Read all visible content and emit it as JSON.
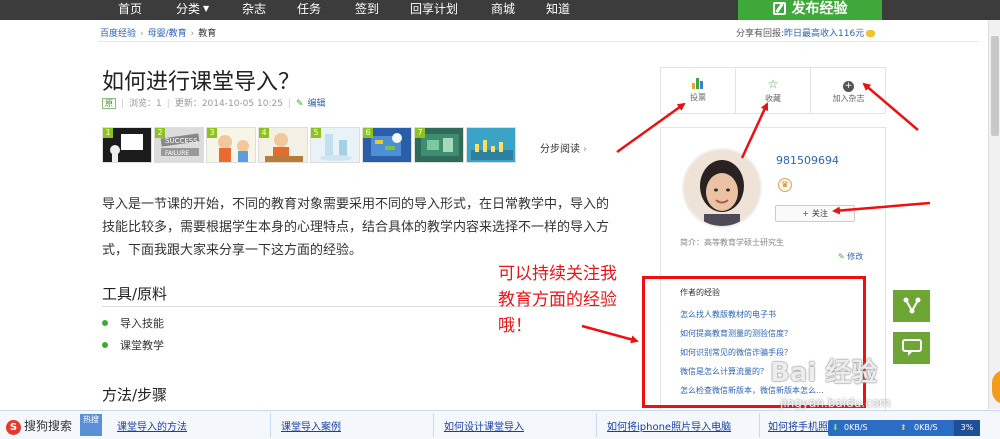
{
  "topnav": {
    "items": [
      "首页",
      "分类",
      "杂志",
      "任务",
      "签到",
      "回享计划",
      "商城",
      "知道"
    ],
    "publish_label": "发布经验"
  },
  "breadcrumb": {
    "items": [
      "百度经验",
      "母婴/教育",
      "教育"
    ],
    "share_tip_prefix": "分享有回报:",
    "share_tip_link": "昨日最高收入116元"
  },
  "article": {
    "title": "如何进行课堂导入？",
    "original_badge": "原",
    "views": "浏览：1",
    "updated": "更新：2014-10-05 10:25",
    "edit_label": "编辑",
    "step_read_label": "分步阅读",
    "thumb_numbers": [
      "1",
      "2",
      "3",
      "4",
      "5",
      "6",
      "7"
    ],
    "intro": "导入是一节课的开始，不同的教育对象需要采用不同的导入形式，在日常教学中，导入的技能比较多，需要根据学生本身的心理特点，结合具体的教学内容来选择不一样的导入方式，下面我跟大家来分享一下这方面的经验。",
    "tools_heading": "工具/原料",
    "tools": [
      "导入技能",
      "课堂教学"
    ],
    "steps_heading": "方法/步骤"
  },
  "sidebar": {
    "actions": [
      {
        "label": "投票",
        "icon": "vote-icon"
      },
      {
        "label": "收藏",
        "icon": "star-icon"
      },
      {
        "label": "加入杂志",
        "icon": "plus-icon"
      }
    ],
    "username": "981509694",
    "follow_label": "关注",
    "bio": "简介：高等教育学硕士研究生",
    "modify_label": "修改",
    "experiences_heading": "作者的经验",
    "experiences": [
      "怎么找人教版教材的电子书",
      "如何提高教育测量的测验信度？",
      "如何识别常见的微信诈骗手段？",
      "微信是怎么计算流量的？",
      "怎么检查微信新版本，微信新版本怎么..."
    ]
  },
  "annotation": {
    "note": "可以持续关注我教育方面的经验哦！"
  },
  "watermark": {
    "text": "Bai 经验",
    "url": "jingyan.baidu.com"
  },
  "bottombar": {
    "sogou_label": "搜狗搜索",
    "hot_label": "热搜",
    "links": [
      "课堂导入的方法",
      "课堂导入案例",
      "如何设计课堂导入",
      "如何将iphone照片导入电脑",
      "如何将手机照"
    ],
    "download_speed": "0KB/S",
    "upload_speed": "0KB/S",
    "percent": "3%"
  },
  "colors": {
    "nav_bg": "#3c3c3c",
    "brand_green": "#3fa83a",
    "link_blue": "#2d64b3",
    "annotation_red": "#ee1010"
  }
}
